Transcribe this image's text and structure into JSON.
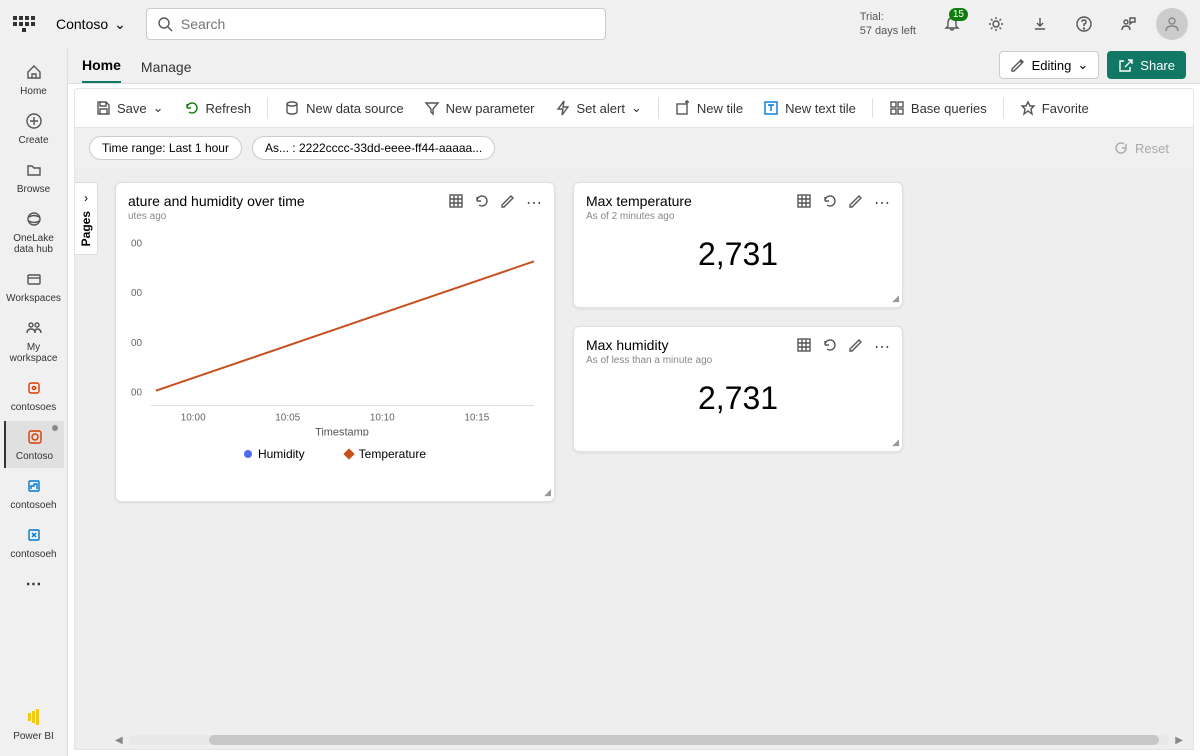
{
  "topbar": {
    "workspace": "Contoso",
    "search_placeholder": "Search",
    "trial_line1": "Trial:",
    "trial_line2": "57 days left",
    "notif_count": "15"
  },
  "leftrail": {
    "items": [
      "Home",
      "Create",
      "Browse",
      "OneLake data hub",
      "Workspaces",
      "My workspace",
      "contosoes",
      "Contoso",
      "contosoeh",
      "contosoeh"
    ],
    "bottom": "Power BI"
  },
  "tabs": {
    "home": "Home",
    "manage": "Manage",
    "editing": "Editing",
    "share": "Share"
  },
  "toolbar": {
    "save": "Save",
    "refresh": "Refresh",
    "new_data_source": "New data source",
    "new_parameter": "New parameter",
    "set_alert": "Set alert",
    "new_tile": "New tile",
    "new_text_tile": "New text tile",
    "base_queries": "Base queries",
    "favorite": "Favorite"
  },
  "filters": {
    "time_range": "Time range: Last 1 hour",
    "asset": "As... : 2222cccc-33dd-eeee-ff44-aaaaa...",
    "reset": "Reset"
  },
  "pages_label": "Pages",
  "tiles": {
    "chart": {
      "title_visible": "ature and humidity over time",
      "sub_visible": "utes ago",
      "xlabel": "Timestamp",
      "legend": [
        "Humidity",
        "Temperature"
      ],
      "y_ticks_visible": [
        "00",
        "00",
        "00",
        "00"
      ]
    },
    "max_temp": {
      "title": "Max temperature",
      "sub": "As of 2 minutes ago",
      "value": "2,731"
    },
    "max_hum": {
      "title": "Max humidity",
      "sub": "As of less than a minute ago",
      "value": "2,731"
    }
  },
  "chart_data": {
    "type": "line",
    "title": "Temperature and humidity over time",
    "xlabel": "Timestamp",
    "ylabel": "",
    "x": [
      "10:00",
      "10:05",
      "10:10",
      "10:15"
    ],
    "series": [
      {
        "name": "Temperature",
        "color": "#c8501e",
        "values_estimated_relative": [
          15,
          40,
          65,
          85
        ]
      },
      {
        "name": "Humidity",
        "color": "#4f6bed",
        "values_estimated_relative": [
          15,
          40,
          65,
          85
        ]
      }
    ],
    "note": "Y-axis numeric values are truncated in screenshot (only '00' suffixes visible); line rises roughly linearly across the visible x range."
  }
}
